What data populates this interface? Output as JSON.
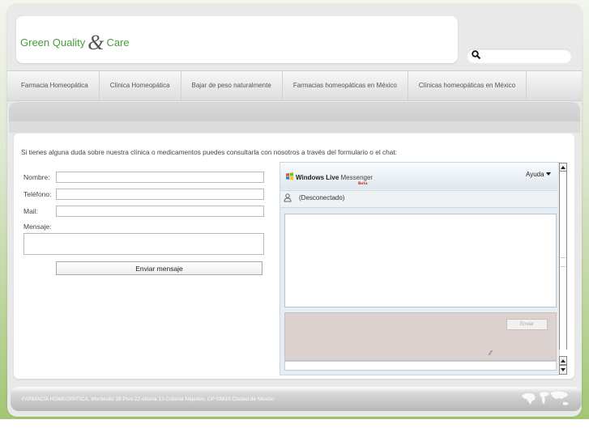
{
  "header": {
    "logo_part1": "Green Quality",
    "logo_amp": "&",
    "logo_part2": "Care",
    "search_placeholder": ""
  },
  "nav": {
    "items": [
      "Farmacia Homeopática",
      "Clínica Homeopática",
      "Bajar de peso naturalmente",
      "Farmacias homeopáticas en México",
      "Clínicas homeopáticas en México"
    ]
  },
  "contact": {
    "intro": "Si tienes alguna duda sobre nuestra clínica o medicamentos puedes consultarla con nosotros a través del formulario o el chat:",
    "name_label": "Nombre:",
    "phone_label": "Teléfono:",
    "mail_label": "Mail:",
    "message_label": "Mensaje:",
    "send_label": "Enviar mensaje"
  },
  "messenger": {
    "brand": "Windows Live",
    "product": "Messenger",
    "beta": "Beta",
    "help_label": "Ayuda",
    "status": "(Desconectado)",
    "send_label": "Enviar"
  },
  "footer": {
    "text": "FARMACIA HOMEOPATICA, Montecito 38 Piso 22 oficina 13 Colonia Nápoles, CP 03810 Ciudad de México"
  },
  "colors": {
    "logo_green": "#4a9b3c",
    "background_green": "#9ec36c"
  }
}
